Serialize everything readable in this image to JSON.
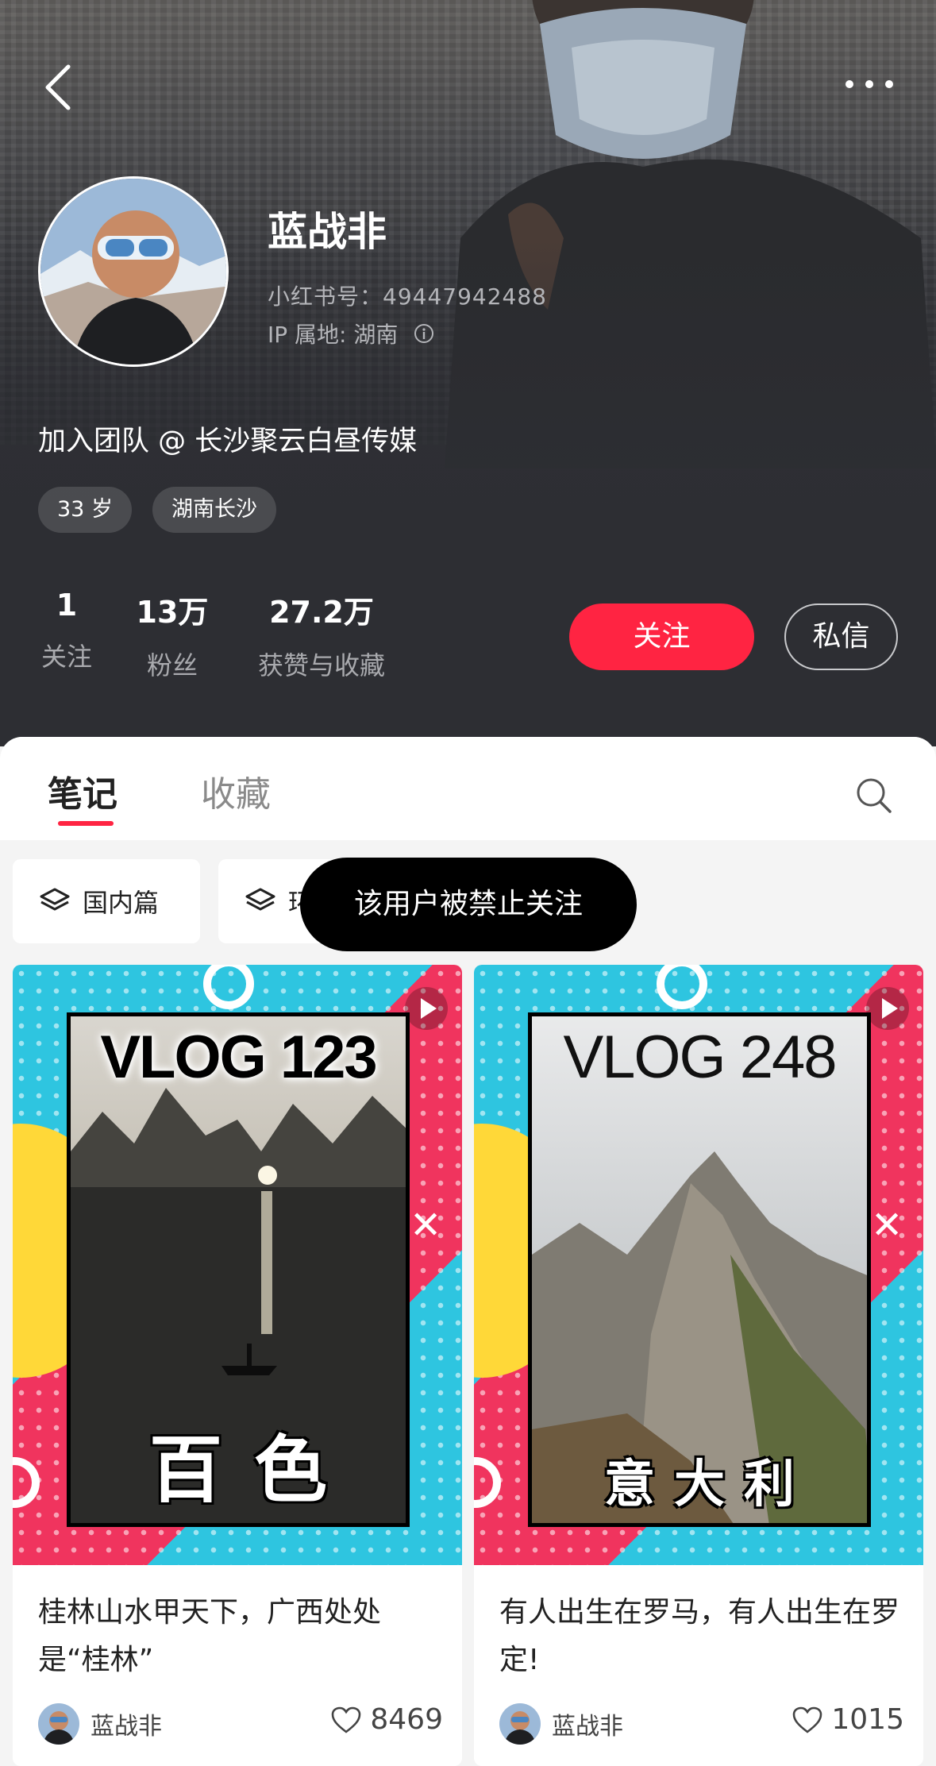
{
  "nav": {
    "back_icon": "chevron-left-icon",
    "more_icon": "more-horizontal-icon"
  },
  "profile": {
    "name": "蓝战非",
    "id_label": "小红书号：49447942488",
    "ip_label": "IP 属地: 湖南",
    "bio": "加入团队 @ 长沙聚云白昼传媒",
    "tags": [
      "33 岁",
      "湖南长沙"
    ]
  },
  "stats": [
    {
      "value": "1",
      "label": "关注"
    },
    {
      "value": "13万",
      "label": "粉丝"
    },
    {
      "value": "27.2万",
      "label": "获赞与收藏"
    }
  ],
  "actions": {
    "follow": "关注",
    "message": "私信"
  },
  "tabs": {
    "notes": "笔记",
    "collect": "收藏",
    "active": "notes"
  },
  "chips": [
    "国内篇",
    "环"
  ],
  "toast": "该用户被禁止关注",
  "cards": [
    {
      "cover_title": "VLOG 123",
      "cover_place": "百色",
      "title": "桂林山水甲天下，广西处处是“桂林”",
      "author": "蓝战非",
      "likes": "8469"
    },
    {
      "cover_title": "VLOG 248",
      "cover_place": "意大利",
      "title": "有人出生在罗马，有人出生在罗定!",
      "author": "蓝战非",
      "likes": "1015"
    }
  ],
  "colors": {
    "accent": "#ff2442",
    "header_bg": "#2d2e33",
    "toast_bg": "#000000"
  }
}
